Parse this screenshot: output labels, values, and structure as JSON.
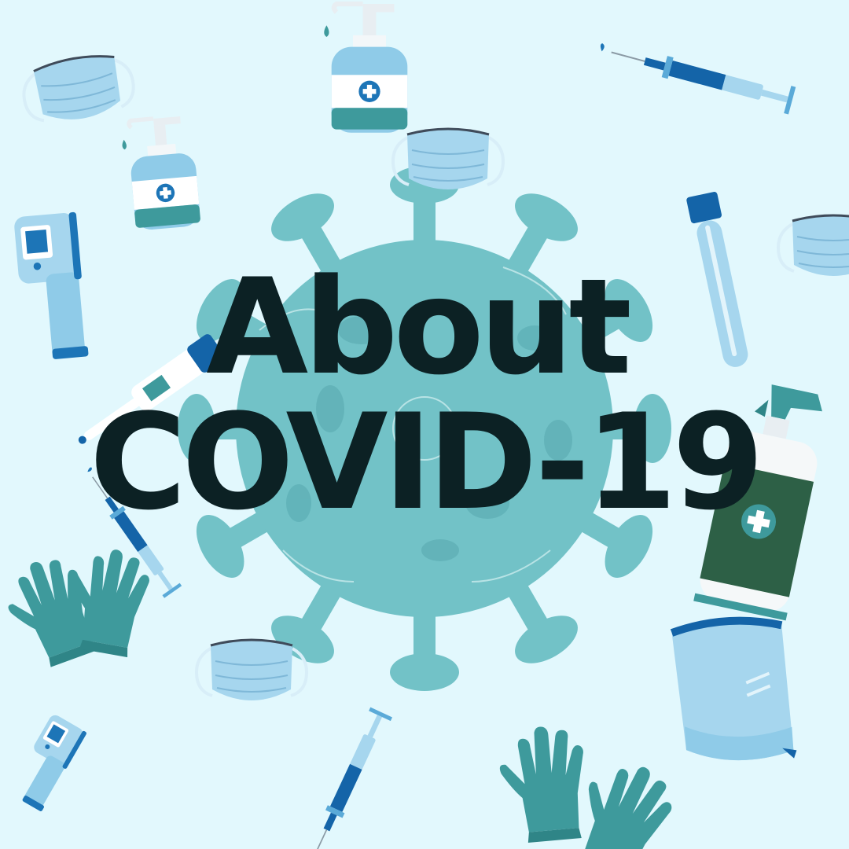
{
  "title": {
    "line1": "About",
    "line2": "COVID-19"
  },
  "colors": {
    "background": "#e2f8fd",
    "virus": "#72c2c7",
    "virus_spot": "#5eafb5",
    "title_text": "#0c2124",
    "glove": "#3e9a9c",
    "mask": "#a6d6ee",
    "bottle_green": "#2d6046",
    "accent_blue": "#1464a8"
  },
  "icons": [
    "virus-icon",
    "mask-icon",
    "sanitizer-pump-icon",
    "syringe-icon",
    "test-tube-icon",
    "thermometer-gun-icon",
    "digital-thermometer-icon",
    "spray-bottle-icon",
    "gloves-icon",
    "face-shield-icon"
  ]
}
